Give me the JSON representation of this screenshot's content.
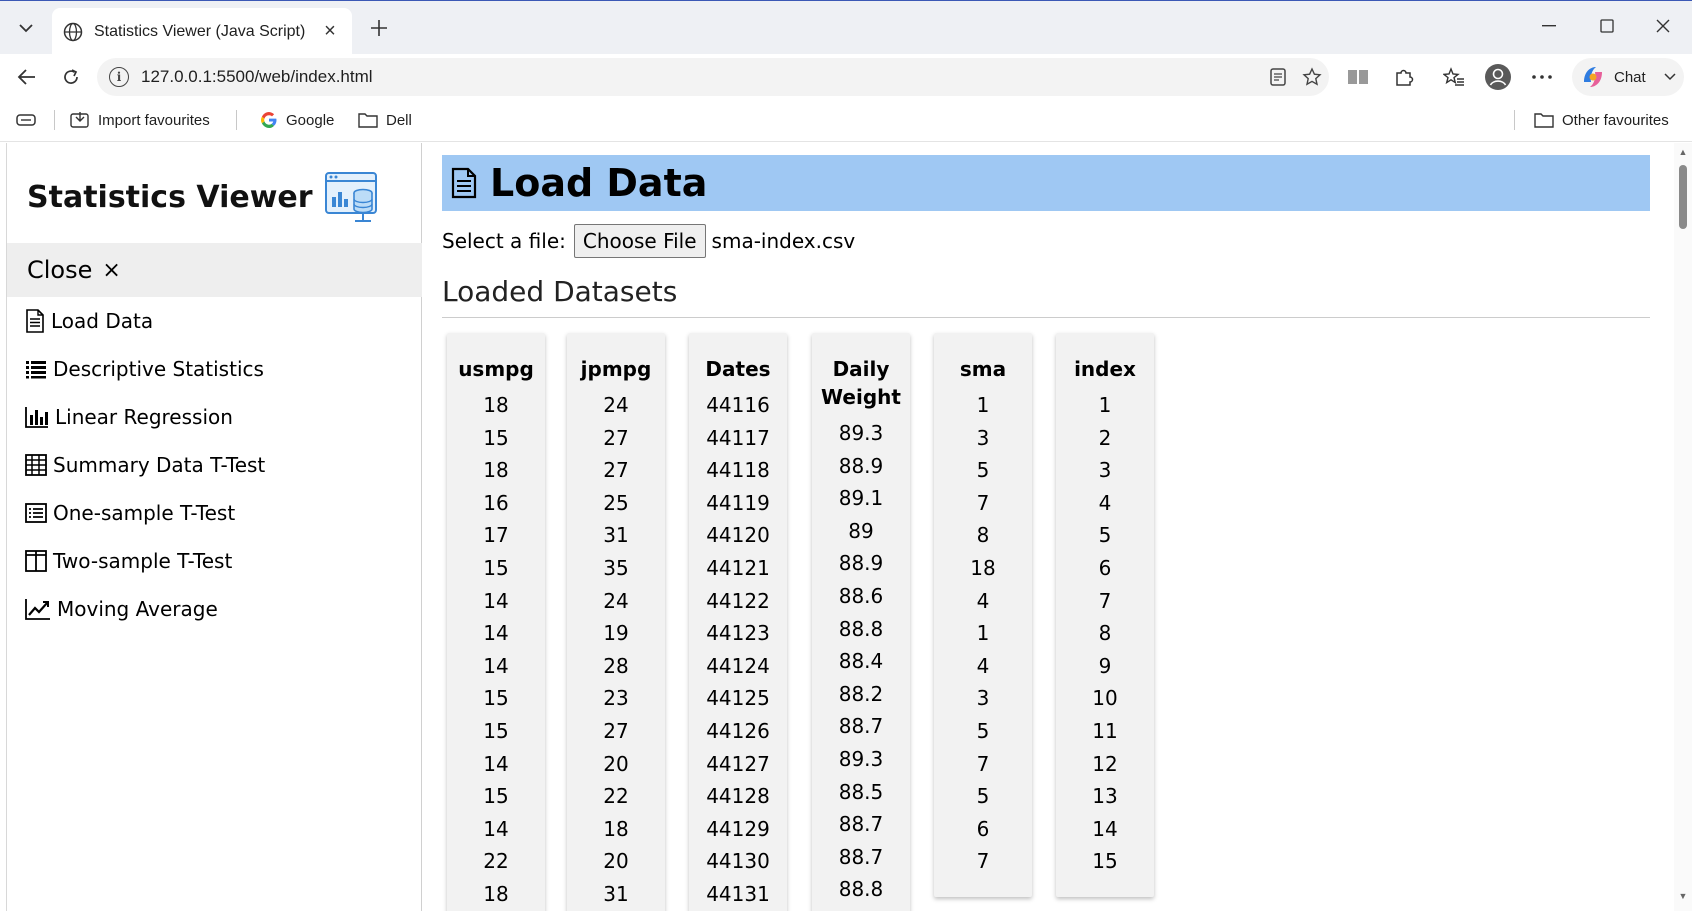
{
  "browser": {
    "tab_title": "Statistics Viewer (Java Script)",
    "url": "127.0.0.1:5500/web/index.html",
    "chat_label": "Chat",
    "favourites": {
      "import": "Import favourites",
      "google": "Google",
      "dell": "Dell",
      "other": "Other favourites"
    }
  },
  "sidebar": {
    "brand": "Statistics Viewer",
    "close_label": "Close",
    "close_symbol": "×",
    "items": [
      {
        "label": "Load Data",
        "icon": "document-icon"
      },
      {
        "label": "Descriptive Statistics",
        "icon": "list-icon"
      },
      {
        "label": "Linear Regression",
        "icon": "bar-chart-icon"
      },
      {
        "label": "Summary Data T-Test",
        "icon": "table-grid-icon"
      },
      {
        "label": "One-sample T-Test",
        "icon": "list-box-icon"
      },
      {
        "label": "Two-sample T-Test",
        "icon": "columns-icon"
      },
      {
        "label": "Moving Average",
        "icon": "line-chart-icon"
      }
    ]
  },
  "main": {
    "header": "Load Data",
    "file_label": "Select a file:",
    "choose_button": "Choose File",
    "file_name": "sma-index.csv",
    "datasets_title": "Loaded Datasets",
    "datasets": [
      {
        "name": "usmpg",
        "values": [
          "18",
          "15",
          "18",
          "16",
          "17",
          "15",
          "14",
          "14",
          "14",
          "15",
          "15",
          "14",
          "15",
          "14",
          "22",
          "18"
        ]
      },
      {
        "name": "jpmpg",
        "values": [
          "24",
          "27",
          "27",
          "25",
          "31",
          "35",
          "24",
          "19",
          "28",
          "23",
          "27",
          "20",
          "22",
          "18",
          "20",
          "31"
        ]
      },
      {
        "name": "Dates",
        "values": [
          "44116",
          "44117",
          "44118",
          "44119",
          "44120",
          "44121",
          "44122",
          "44123",
          "44124",
          "44125",
          "44126",
          "44127",
          "44128",
          "44129",
          "44130",
          "44131"
        ]
      },
      {
        "name_line1": "Daily",
        "name_line2": "Weight",
        "values": [
          "89.3",
          "88.9",
          "89.1",
          "89",
          "88.9",
          "88.6",
          "88.8",
          "88.4",
          "88.2",
          "88.7",
          "89.3",
          "88.5",
          "88.7",
          "88.7",
          "88.8"
        ]
      },
      {
        "name": "sma",
        "values": [
          "1",
          "3",
          "5",
          "7",
          "8",
          "18",
          "4",
          "1",
          "4",
          "3",
          "5",
          "7",
          "5",
          "6",
          "7"
        ]
      },
      {
        "name": "index",
        "values": [
          "1",
          "2",
          "3",
          "4",
          "5",
          "6",
          "7",
          "8",
          "9",
          "10",
          "11",
          "12",
          "13",
          "14",
          "15"
        ]
      }
    ]
  }
}
